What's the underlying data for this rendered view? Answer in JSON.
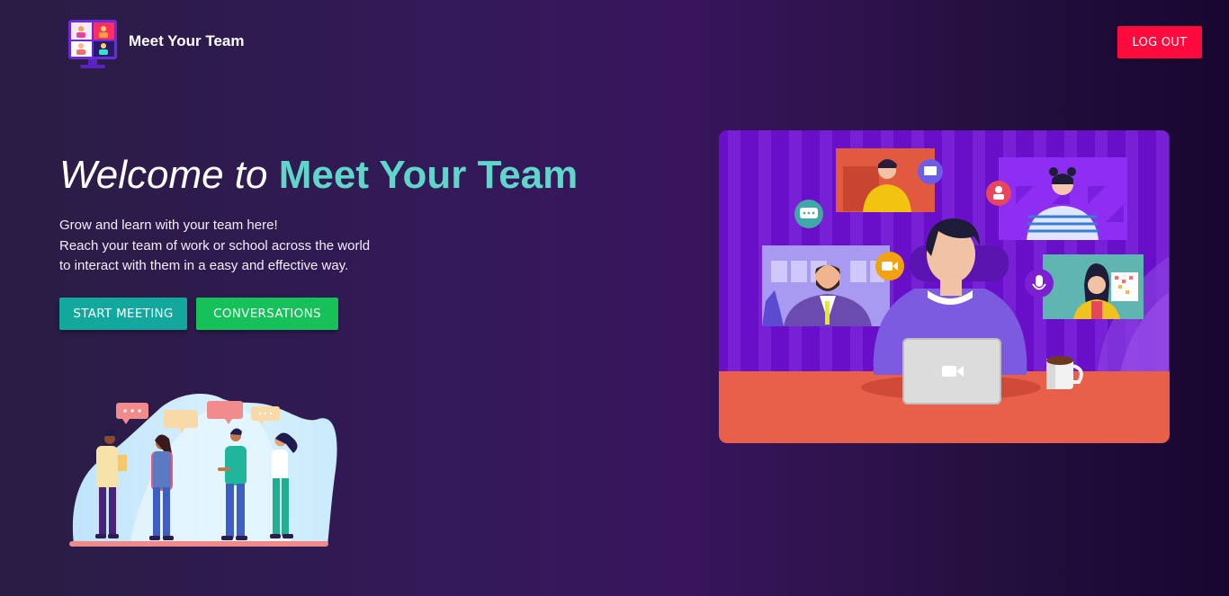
{
  "app": {
    "name": "Meet Your Team",
    "logo_icon": "video-conference-monitor-icon"
  },
  "navbar": {
    "logout_label": "LOG OUT"
  },
  "hero": {
    "title_prefix": "Welcome to",
    "title_highlight": "Meet Your Team",
    "lines": [
      "Grow and learn with your team here!",
      "Reach your team of work or school across the world",
      "to interact with them in a easy and effective way."
    ],
    "start_meeting_label": "START MEETING",
    "conversations_label": "CONVERSATIONS"
  },
  "colors": {
    "accent_teal": "#5fd6c9",
    "logout_red": "#ff0a3c",
    "start_button": "#13a89e",
    "conversations_button": "#16c15a",
    "background": "#331a58"
  },
  "illustrations": {
    "team": "team-chatting-illustration",
    "meeting": "video-meeting-illustration"
  }
}
